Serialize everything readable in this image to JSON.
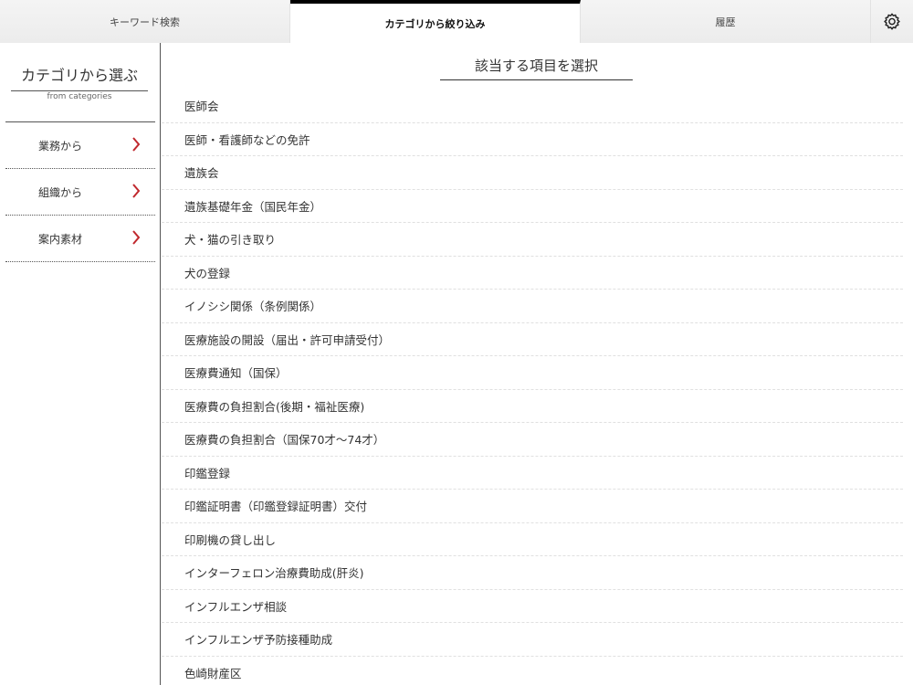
{
  "tabs": {
    "keyword": "キーワード検索",
    "category": "カテゴリから絞り込み",
    "history": "履歴"
  },
  "sidebar": {
    "title": "カテゴリから選ぶ",
    "subtitle": "from categories",
    "items": [
      {
        "label": "業務から"
      },
      {
        "label": "組織から"
      },
      {
        "label": "案内素材"
      }
    ]
  },
  "main": {
    "title": "該当する項目を選択",
    "items": [
      "医師会",
      "医師・看護師などの免許",
      "遺族会",
      "遺族基礎年金（国民年金）",
      "犬・猫の引き取り",
      "犬の登録",
      "イノシシ関係（条例関係）",
      "医療施設の開設（届出・許可申請受付）",
      "医療費通知（国保）",
      "医療費の負担割合(後期・福祉医療)",
      "医療費の負担割合（国保70才〜74才）",
      "印鑑登録",
      "印鑑証明書（印鑑登録証明書）交付",
      "印刷機の貸し出し",
      "インターフェロン治療費助成(肝炎)",
      "インフルエンザ相談",
      "インフルエンザ予防接種助成",
      "色崎財産区"
    ]
  },
  "colors": {
    "accent": "#c0282d",
    "active_tab_bar": "#000000"
  },
  "icons": {
    "settings": "gear-icon",
    "chevron": "chevron-right-icon"
  }
}
